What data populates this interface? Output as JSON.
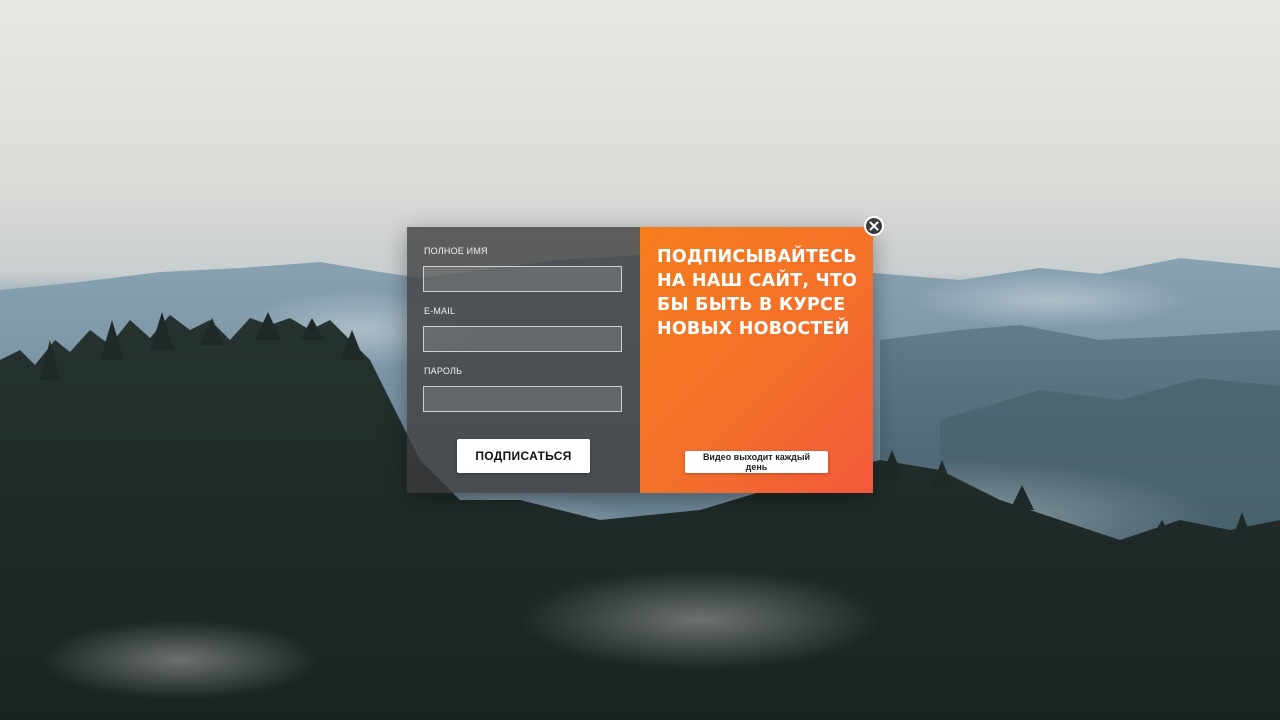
{
  "form": {
    "fields": [
      {
        "label": "ПОЛНОЕ ИМЯ",
        "value": "",
        "placeholder": ""
      },
      {
        "label": "E-MAIL",
        "value": "",
        "placeholder": ""
      },
      {
        "label": "ПАРОЛЬ",
        "value": "",
        "placeholder": ""
      }
    ],
    "submit_label": "ПОДПИСАТЬСЯ"
  },
  "promo": {
    "headline": "ПОДПИСЫВАЙТЕСЬ НА НАШ САЙТ, ЧТО БЫ БЫТЬ В КУРСЕ НОВЫХ НОВОСТЕЙ",
    "button_label": "Видео выходит каждый день"
  },
  "close": {
    "icon": "close-icon"
  },
  "colors": {
    "accent_orange": "#f57e1d",
    "accent_red": "#f2583c",
    "form_panel": "#3c3c3c"
  }
}
